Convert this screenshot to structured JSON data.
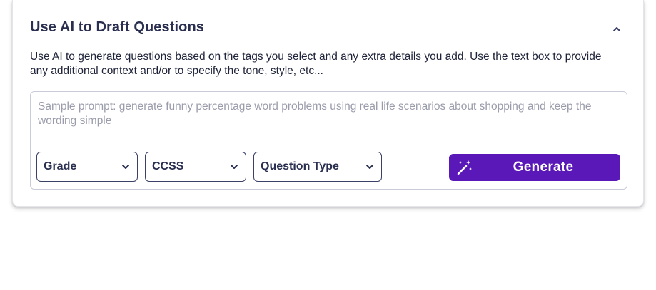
{
  "panel": {
    "title": "Use AI to Draft Questions",
    "collapse_icon": "chevron-up-icon",
    "description": "Use AI to generate questions based on the tags you select and any extra details you add. Use the text box to provide any additional context and/or to specify the tone, style, etc...",
    "prompt": {
      "value": "",
      "placeholder": "Sample prompt: generate funny percentage word problems using real life scenarios about shopping and keep the wording simple"
    },
    "filters": [
      {
        "label": "Grade",
        "icon": "chevron-down-icon"
      },
      {
        "label": "CCSS",
        "icon": "chevron-down-icon"
      },
      {
        "label": "Question Type",
        "icon": "chevron-down-icon"
      }
    ],
    "generate": {
      "label": "Generate",
      "icon": "magic-wand-icon"
    }
  },
  "colors": {
    "accent": "#5b18b8",
    "title_text": "#2a2f4f",
    "body_text": "#20243a",
    "placeholder_text": "#9a9cab",
    "border": "#c9cbd6"
  }
}
